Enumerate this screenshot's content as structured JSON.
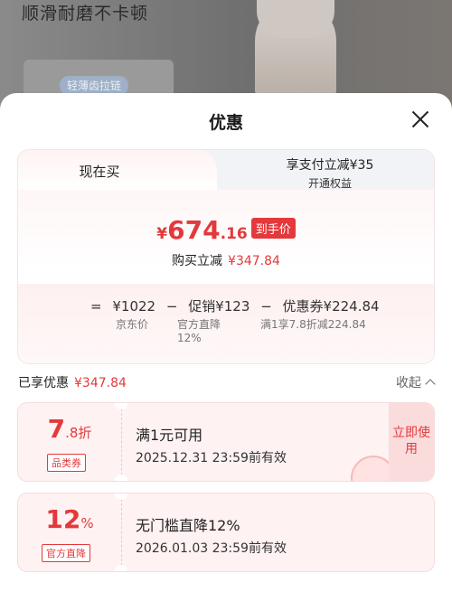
{
  "background": {
    "banner_text": "顺滑耐磨不卡顿",
    "tag": "轻薄齿拉链"
  },
  "sheet": {
    "title": "优惠"
  },
  "tabs": {
    "active": "现在买",
    "other_title": "享支付立减¥35",
    "other_sub": "开通权益"
  },
  "price": {
    "currency": "¥",
    "integer": "674",
    "decimal": ".16",
    "badge": "到手价",
    "save_label": "购买立减",
    "save_amount": "¥347.84"
  },
  "breakdown": {
    "row": [
      "=",
      "¥1022",
      "−",
      "促销¥123",
      "−",
      "优惠券¥224.84"
    ],
    "sub_jd": "京东价",
    "sub_official": "官方直降",
    "sub_official_pct": "12%",
    "sub_coupon": "满1享7.8折减224.84"
  },
  "enjoyed": {
    "label": "已享优惠",
    "amount": "¥347.84",
    "collapse": "收起"
  },
  "coupons": [
    {
      "value_big": "7",
      "value_small": ".8折",
      "tag": "品类券",
      "title": "满1元可用",
      "date": "2025.12.31 23:59前有效",
      "button": "立即使用"
    },
    {
      "value_big": "12",
      "value_small": "%",
      "tag": "官方直降",
      "title": "无门槛直降12%",
      "date": "2026.01.03 23:59前有效"
    }
  ],
  "colors": {
    "accent": "#e4393c"
  }
}
